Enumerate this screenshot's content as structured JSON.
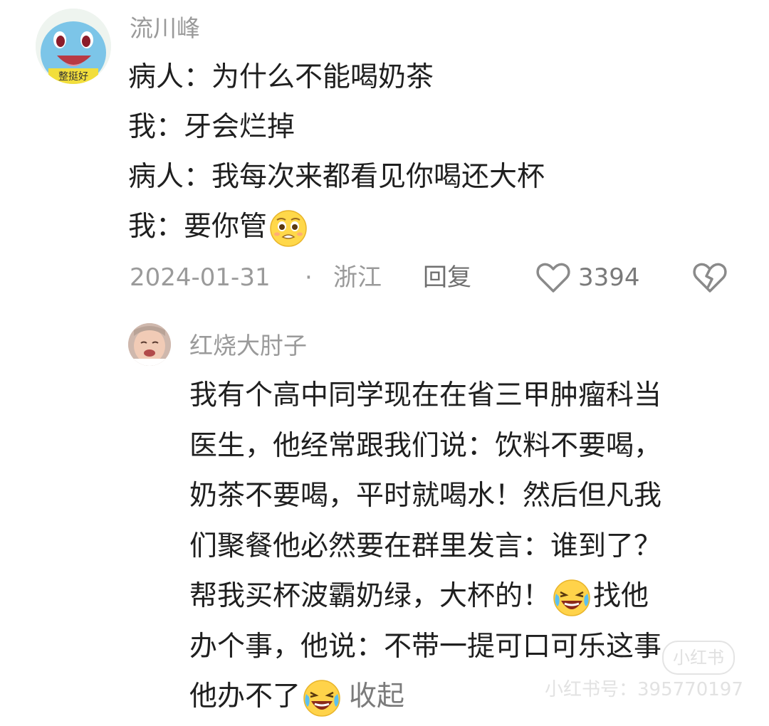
{
  "comment": {
    "username": "流川峰",
    "avatar_badge": "整挺好",
    "lines": [
      "病人：为什么不能喝奶茶",
      "我：牙会烂掉",
      "病人：我每次来都看见你喝还大杯",
      "我：要你管"
    ],
    "date": "2024-01-31",
    "separator": "·",
    "location": "浙江",
    "reply_label": "回复",
    "like_count": "3394",
    "icons": [
      "heart-icon",
      "broken-heart-icon",
      "pleading-face-emoji",
      "laughing-crying-emoji"
    ]
  },
  "reply": {
    "username": "红烧大肘子",
    "lines": [
      "我有个高中同学现在在省三甲肿瘤科当",
      "医生，他经常跟我们说：饮料不要喝，",
      "奶茶不要喝，平时就喝水！然后但凡我",
      "们聚餐他必然要在群里发言：谁到了？",
      "帮我买杯波霸奶绿，大杯的！",
      "找他",
      "办个事，他说：不带一提可口可乐这事",
      "他办不了"
    ],
    "collapse_label": "收起"
  },
  "watermark": {
    "circle_text": "小红书",
    "text": "小红书号：395770197"
  }
}
